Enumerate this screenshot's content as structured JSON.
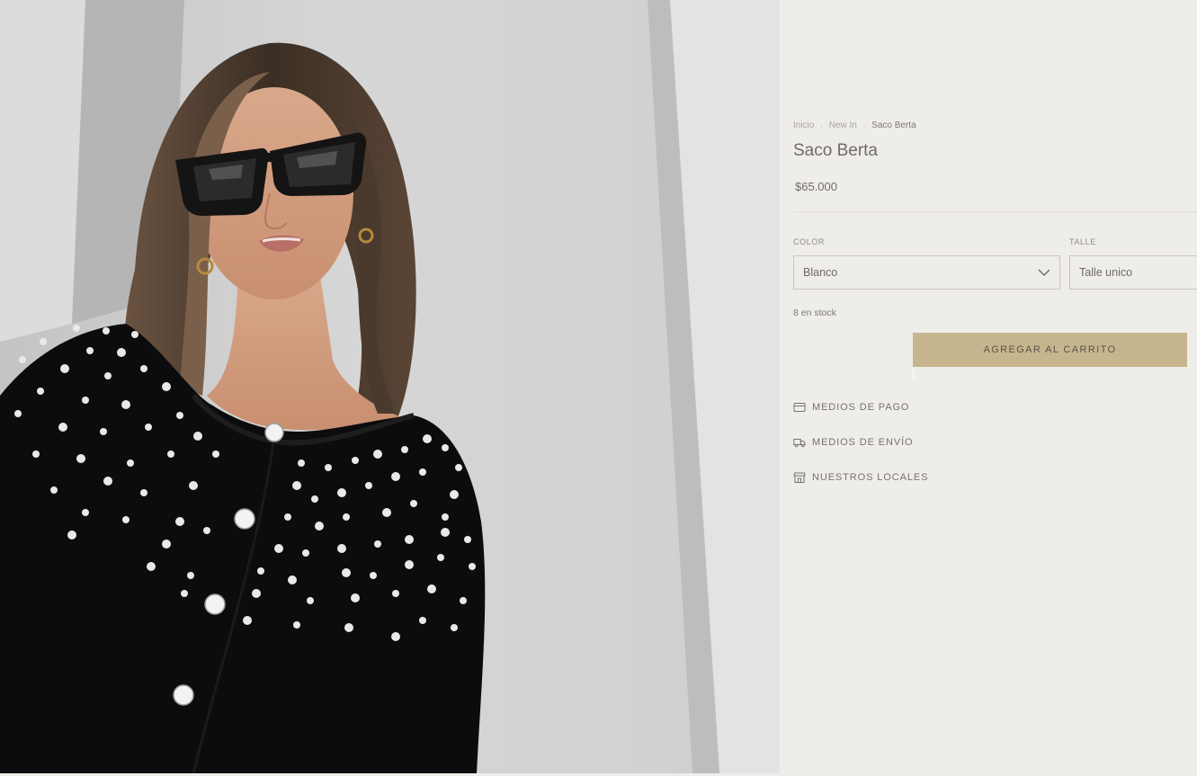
{
  "product_image": {
    "icon": "product-photo"
  },
  "breadcrumb": {
    "items": [
      "Inicio",
      "New In",
      "Saco Berta"
    ],
    "separator": "."
  },
  "product": {
    "title": "Saco Berta",
    "price": "$65.000",
    "stock": "8 en stock"
  },
  "variants": {
    "color_label": "COLOR",
    "color_value": "Blanco",
    "size_label": "TALLE",
    "size_value": "Talle unico"
  },
  "cart": {
    "button_label": "AGREGAR AL CARRITO"
  },
  "info_links": [
    {
      "label": "MEDIOS DE PAGO",
      "icon": "credit-card-icon"
    },
    {
      "label": "MEDIOS DE ENVÍO",
      "icon": "truck-icon"
    },
    {
      "label": "NUESTROS LOCALES",
      "icon": "store-icon"
    }
  ],
  "colors": {
    "panel_background": "#efedea",
    "accent_button": "#c6b58e",
    "text_primary": "#6f6c66",
    "text_muted": "#a7a39c"
  }
}
